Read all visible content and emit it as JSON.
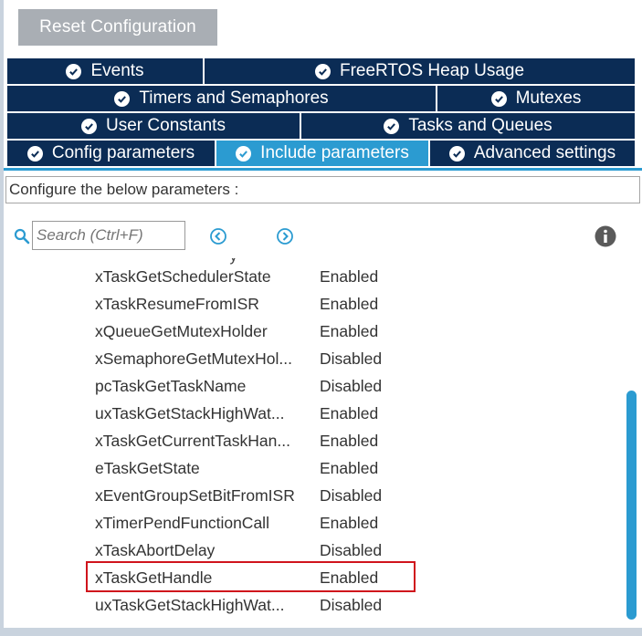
{
  "toolbar": {
    "reset_label": "Reset Configuration"
  },
  "tabs": {
    "row1": [
      {
        "label": "Events",
        "active": false
      },
      {
        "label": "FreeRTOS Heap Usage",
        "active": false
      }
    ],
    "row2": [
      {
        "label": "Timers and Semaphores",
        "active": false
      },
      {
        "label": "Mutexes",
        "active": false
      }
    ],
    "row3": [
      {
        "label": "User Constants",
        "active": false
      },
      {
        "label": "Tasks and Queues",
        "active": false
      }
    ],
    "row4": [
      {
        "label": "Config parameters",
        "active": false
      },
      {
        "label": "Include parameters",
        "active": true
      },
      {
        "label": "Advanced settings",
        "active": false
      }
    ]
  },
  "config": {
    "label": "Configure the below parameters :"
  },
  "search": {
    "placeholder": "Search (Ctrl+F)"
  },
  "icons": {
    "search": "search-icon",
    "prev": "chevron-left-circle-icon",
    "next": "chevron-right-circle-icon",
    "info": "info-icon",
    "tab_check": "check-circle-icon"
  },
  "parameters": [
    {
      "name": "xTaskGetSchedulerState",
      "value": "Enabled"
    },
    {
      "name": "xTaskResumeFromISR",
      "value": "Enabled"
    },
    {
      "name": "xQueueGetMutexHolder",
      "value": "Enabled"
    },
    {
      "name": "xSemaphoreGetMutexHol...",
      "value": "Disabled"
    },
    {
      "name": "pcTaskGetTaskName",
      "value": "Disabled"
    },
    {
      "name": "uxTaskGetStackHighWat...",
      "value": "Enabled"
    },
    {
      "name": "xTaskGetCurrentTaskHan...",
      "value": "Enabled"
    },
    {
      "name": "eTaskGetState",
      "value": "Enabled"
    },
    {
      "name": "xEventGroupSetBitFromISR",
      "value": "Disabled"
    },
    {
      "name": "xTimerPendFunctionCall",
      "value": "Enabled"
    },
    {
      "name": "xTaskAbortDelay",
      "value": "Disabled"
    },
    {
      "name": "xTaskGetHandle",
      "value": "Enabled",
      "highlighted": true
    },
    {
      "name": "uxTaskGetStackHighWat...",
      "value": "Disabled"
    }
  ],
  "colors": {
    "tab_bg": "#0b2c55",
    "tab_active": "#2b9bd1",
    "highlight_border": "#d0141c",
    "reset_button": "#a9aeb4"
  }
}
